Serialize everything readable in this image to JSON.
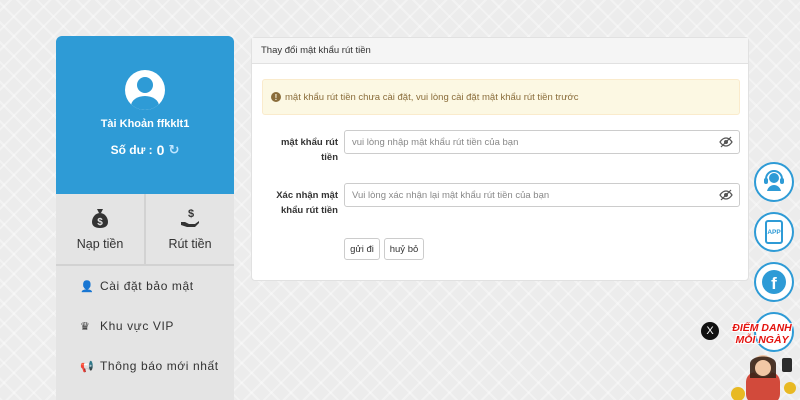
{
  "sidebar": {
    "account_label": "Tài Khoản ffkklt1",
    "balance_label": "Số dư :",
    "balance_value": "0",
    "actions": [
      {
        "label": "Nạp tiền",
        "icon": "money-bag-icon"
      },
      {
        "label": "Rút tiền",
        "icon": "hand-dollar-icon"
      }
    ],
    "menu": [
      {
        "label": "Cài đặt bảo mật",
        "icon": "user-lock-icon"
      },
      {
        "label": "Khu vực VIP",
        "icon": "vip-crown-icon"
      },
      {
        "label": "Thông báo mới nhất",
        "icon": "megaphone-icon"
      }
    ]
  },
  "panel": {
    "title": "Thay đổi mật khẩu rút tiền",
    "alert": "mật khẩu rút tiền chưa cài đặt, vui lòng cài đặt mật khẩu rút tiền trước",
    "fields": [
      {
        "label": "mật khẩu rút tiền",
        "placeholder": "vui lòng nhập mật khẩu rút tiền của bạn",
        "value": ""
      },
      {
        "label": "Xác nhận mật khẩu rút tiền",
        "placeholder": "Vui lòng xác nhận lại mật khẩu rút tiền của bạn",
        "value": ""
      }
    ],
    "submit_label": "gửi đi",
    "cancel_label": "huỷ bỏ"
  },
  "floating": {
    "app_label": "APP",
    "facebook_letter": "f",
    "close_label": "X",
    "promo_title_1": "ĐIỂM DANH",
    "promo_title_2": "MỖI NGÀY"
  },
  "colors": {
    "brand_blue": "#2e9bd6",
    "alert_bg": "#fcf8e3",
    "alert_text": "#8a6d3b",
    "promo_red": "#e4140f"
  }
}
